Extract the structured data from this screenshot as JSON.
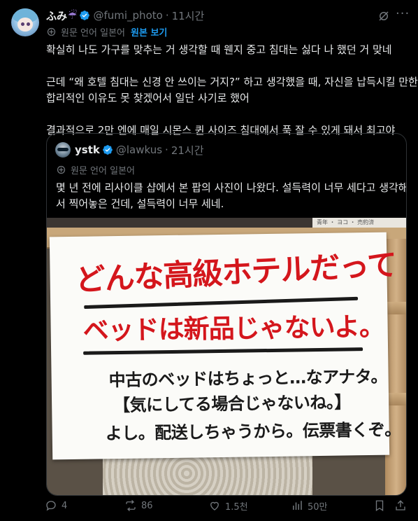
{
  "post": {
    "author_name": "ふみ",
    "author_emoji": "☔",
    "handle": "@fumi_photo",
    "dot": "·",
    "time": "11시간",
    "translated_label": "원문 언어 일본어",
    "show_original": "원본 보기",
    "text_lines": [
      "확실히 나도 가구를 맞추는 거 생각할 때 웬지 중고 침대는 싫다 나 했던 거 맞네",
      "",
      "근데 “왜 호텔 침대는 신경 안 쓰이는 거지?” 하고 생각했을 때, 자신을 납득시킬 만한",
      "합리적인 이유도 못 찾겠어서 일단 사기로 했어",
      "",
      "결과적으로 2만 엔에 매일 시몬스 퀸 사이즈 침대에서 푹 잘 수 있게 돼서 최고야"
    ]
  },
  "quote": {
    "author_name": "ystk",
    "handle": "@lawkus",
    "dot": "·",
    "time": "21시간",
    "translated_label": "원문 언어 일본어",
    "text_lines": [
      "몇 년 전에 리사이클 샵에서 본 팝의 사진이 나왔다. 설득력이 너무 세다고 생각해",
      "서 찍어놓은 건데, 설득력이 너무 세네."
    ],
    "photo_tag": "青年 ・ ヨコ ・ 売約済",
    "sign": {
      "line1": "どんな高級ホテルだって",
      "line2": "ベッドは新品じゃないよ。",
      "line3": "中古のベッドはちょっと…なアナタ。",
      "line4": "【気にしてる場合じゃないね。】",
      "line5": "よし。配送しちゃうから。伝票書くぞ。"
    }
  },
  "actions": {
    "replies": "4",
    "reposts": "86",
    "likes": "1.5천",
    "views": "50만"
  },
  "colors": {
    "background": "#000000",
    "text": "#e7e9ea",
    "muted": "#71767b",
    "accent": "#1d9bf0",
    "sign_red": "#d4161c"
  },
  "icons": [
    "verified-badge-icon",
    "grok-icon",
    "more-icon",
    "translate-icon",
    "reply-icon",
    "repost-icon",
    "like-icon",
    "views-icon",
    "bookmark-icon",
    "share-icon"
  ]
}
